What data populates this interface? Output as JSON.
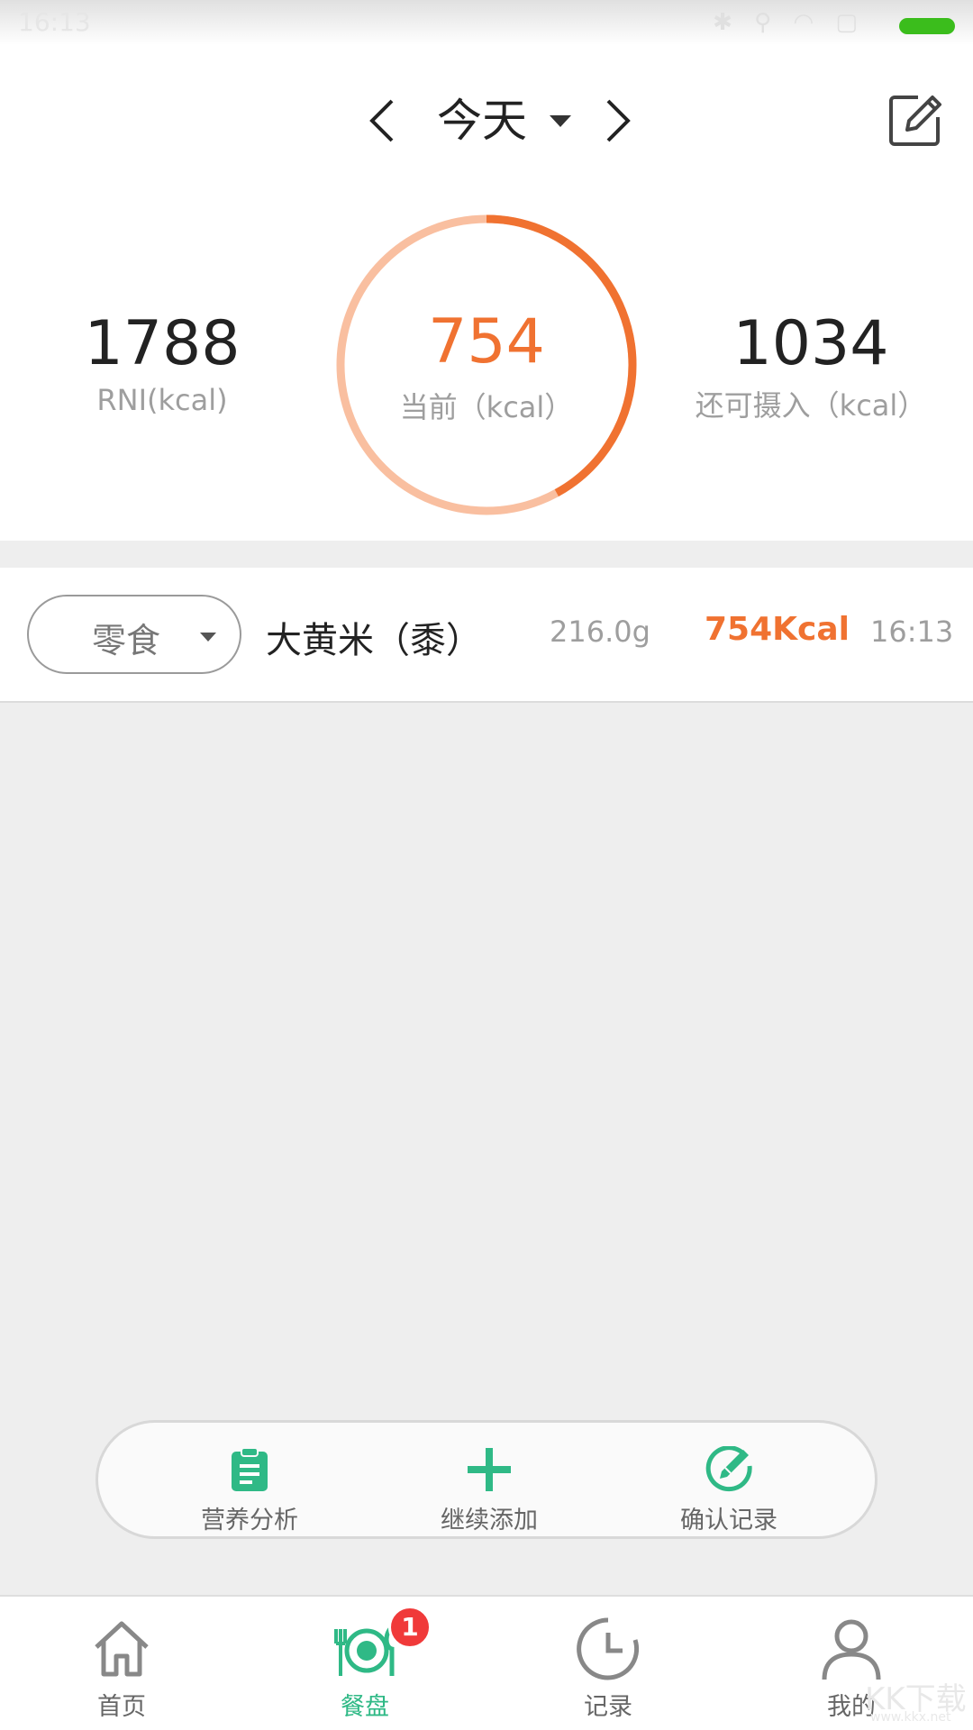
{
  "status_bar": {
    "time": "16:13"
  },
  "header": {
    "date_label": "今天"
  },
  "summary": {
    "rni": {
      "value": "1788",
      "label": "RNI(kcal)"
    },
    "current": {
      "value": "754",
      "label": "当前（kcal）",
      "progress": 0.42
    },
    "remaining": {
      "value": "1034",
      "label": "还可摄入（kcal）"
    }
  },
  "food_entry": {
    "meal": "零食",
    "name": "大黄米（黍）",
    "weight": "216.0g",
    "kcal": "754Kcal",
    "time": "16:13"
  },
  "actions": [
    {
      "label": "营养分析",
      "icon": "clipboard-icon"
    },
    {
      "label": "继续添加",
      "icon": "plus-icon"
    },
    {
      "label": "确认记录",
      "icon": "check-pencil-icon"
    }
  ],
  "bottom_nav": [
    {
      "label": "首页",
      "icon": "home-icon"
    },
    {
      "label": "餐盘",
      "icon": "plate-icon",
      "badge": "1",
      "active": true
    },
    {
      "label": "记录",
      "icon": "clock-icon"
    },
    {
      "label": "我的",
      "icon": "user-icon"
    }
  ],
  "watermark": {
    "text": "KK下载",
    "url": "www.kkx.net"
  },
  "colors": {
    "accent_orange": "#f07231",
    "ring_light": "#f9bfa0",
    "accent_green": "#2fb986",
    "badge_red": "#f03a3a"
  }
}
